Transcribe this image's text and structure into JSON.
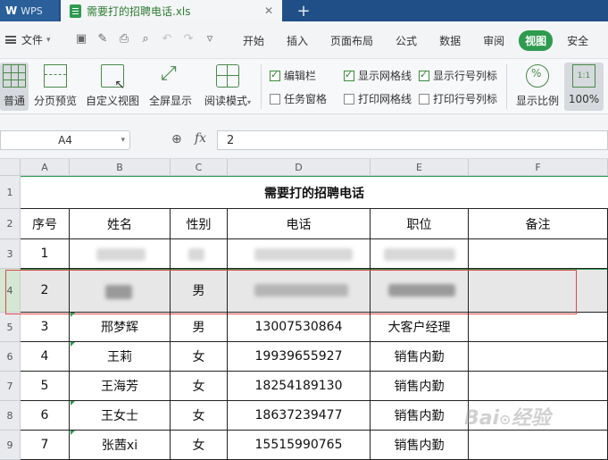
{
  "titlebar": {
    "app_name": "WPS",
    "app_logo": "W",
    "doc_tab": "需要打的招聘电话.xls",
    "close_glyph": "✕",
    "new_tab_glyph": "+"
  },
  "menubar": {
    "file_label": "文件",
    "tabs": [
      "开始",
      "插入",
      "页面布局",
      "公式",
      "数据",
      "审阅",
      "视图",
      "安全"
    ],
    "active_tab": "视图",
    "accent_color": "#2e9b4f"
  },
  "toolbar": {
    "normal_label": "普通",
    "page_preview_label": "分页预览",
    "custom_view_label": "自定义视图",
    "fullscreen_label": "全屏显示",
    "reading_mode_label": "阅读模式",
    "checkboxes": {
      "formula_bar": {
        "label": "编辑栏",
        "checked": true
      },
      "task_pane": {
        "label": "任务窗格",
        "checked": false
      },
      "show_gridlines": {
        "label": "显示网格线",
        "checked": true
      },
      "print_gridlines": {
        "label": "打印网格线",
        "checked": false
      },
      "show_headers": {
        "label": "显示行号列标",
        "checked": true
      },
      "print_headers": {
        "label": "打印行号列标",
        "checked": false
      }
    },
    "zoom_label": "显示比例",
    "zoom100_label": "100%",
    "zoom100_icon_text": "1:1"
  },
  "formula_bar": {
    "cell_ref": "A4",
    "fx_label": "fx",
    "value": "2"
  },
  "sheet": {
    "columns": [
      "A",
      "B",
      "C",
      "D",
      "E",
      "F"
    ],
    "rows": [
      "1",
      "2",
      "3",
      "4",
      "5",
      "6",
      "7",
      "8",
      "9"
    ],
    "title": "需要打的招聘电话",
    "headers": [
      "序号",
      "姓名",
      "性别",
      "电话",
      "职位",
      "备注"
    ],
    "data": [
      [
        "1",
        "",
        "",
        "",
        "",
        ""
      ],
      [
        "2",
        "",
        "男",
        "",
        "",
        ""
      ],
      [
        "3",
        "邢梦辉",
        "男",
        "13007530864",
        "大客户经理",
        ""
      ],
      [
        "4",
        "王莉",
        "女",
        "19939655927",
        "销售内勤",
        ""
      ],
      [
        "5",
        "王海芳",
        "女",
        "18254189130",
        "销售内勤",
        ""
      ],
      [
        "6",
        "王女士",
        "女",
        "18637239477",
        "销售内勤",
        ""
      ],
      [
        "7",
        "张茜xi",
        "女",
        "15515990765",
        "销售内勤",
        ""
      ]
    ],
    "selected_row": "4"
  }
}
